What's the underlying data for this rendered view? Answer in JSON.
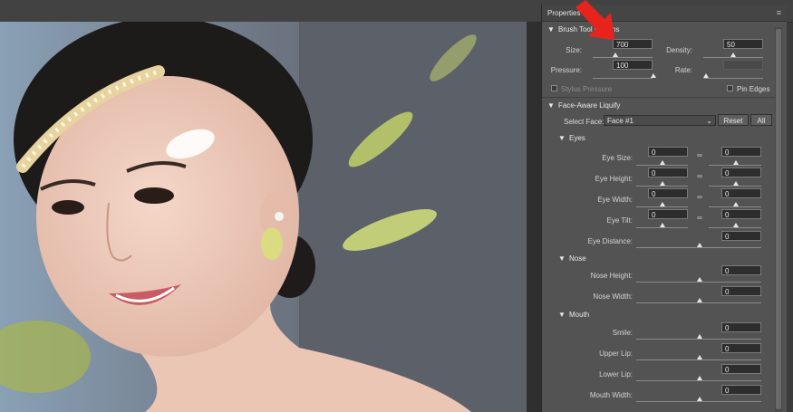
{
  "panel": {
    "title": "Properties"
  },
  "brush_tool_options": {
    "header": "Brush Tool Options",
    "size": {
      "label": "Size:",
      "value": "700"
    },
    "density": {
      "label": "Density:",
      "value": "50"
    },
    "pressure": {
      "label": "Pressure:",
      "value": "100"
    },
    "rate": {
      "label": "Rate:",
      "value": ""
    },
    "stylus_pressure": {
      "label": "Stylus Pressure"
    },
    "pin_edges": {
      "label": "Pin Edges"
    }
  },
  "face_aware": {
    "header": "Face-Aware Liquify",
    "select_face_label": "Select Face:",
    "select_face_value": "Face #1",
    "reset_label": "Reset",
    "all_label": "All",
    "eyes": {
      "header": "Eyes",
      "eye_size": {
        "label": "Eye Size:",
        "left": "0",
        "right": "0"
      },
      "eye_height": {
        "label": "Eye Height:",
        "left": "0",
        "right": "0"
      },
      "eye_width": {
        "label": "Eye Width:",
        "left": "0",
        "right": "0"
      },
      "eye_tilt": {
        "label": "Eye Tilt:",
        "left": "0",
        "right": "0"
      },
      "eye_distance": {
        "label": "Eye Distance:",
        "value": "0"
      }
    },
    "nose": {
      "header": "Nose",
      "nose_height": {
        "label": "Nose Height:",
        "value": "0"
      },
      "nose_width": {
        "label": "Nose Width:",
        "value": "0"
      }
    },
    "mouth": {
      "header": "Mouth",
      "smile": {
        "label": "Smile:",
        "value": "0"
      },
      "upper_lip": {
        "label": "Upper Lip:",
        "value": "0"
      },
      "lower_lip": {
        "label": "Lower Lip:",
        "value": "0"
      },
      "mouth_width": {
        "label": "Mouth Width:",
        "value": "0"
      }
    }
  },
  "icons": {
    "collapse": "triangle-down-icon",
    "link": "chain-link-icon",
    "annotation": "red-arrow-icon"
  },
  "colors": {
    "panel_bg": "#535353",
    "field_bg": "#2d2d2d",
    "arrow": "#e8231c"
  }
}
